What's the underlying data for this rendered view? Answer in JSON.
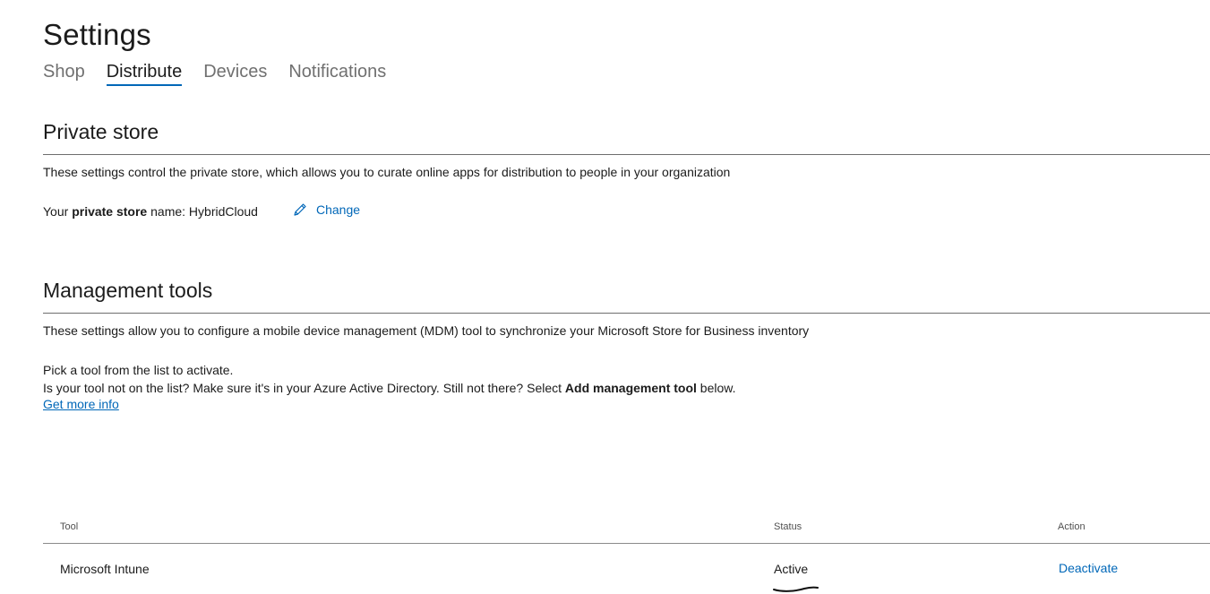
{
  "page": {
    "title": "Settings"
  },
  "tabs": [
    {
      "label": "Shop",
      "active": false
    },
    {
      "label": "Distribute",
      "active": true
    },
    {
      "label": "Devices",
      "active": false
    },
    {
      "label": "Notifications",
      "active": false
    }
  ],
  "private_store": {
    "heading": "Private store",
    "description": "These settings control the private store, which allows you to curate online apps for distribution to people in your organization",
    "name_prefix": "Your ",
    "name_bold": "private store",
    "name_suffix": " name: HybridCloud",
    "change_label": "Change",
    "change_icon": "pencil-icon"
  },
  "management_tools": {
    "heading": "Management tools",
    "description": "These settings allow you to configure a mobile device management (MDM) tool to synchronize your Microsoft Store for Business inventory",
    "pick_text": "Pick a tool from the list to activate.",
    "not_listed_prefix": "Is your tool not on the list? Make sure it's in your Azure Active Directory. Still not there? Select ",
    "not_listed_bold": "Add management tool",
    "not_listed_suffix": " below.",
    "more_info_label": "Get more info"
  },
  "table": {
    "headers": {
      "tool": "Tool",
      "status": "Status",
      "action": "Action"
    },
    "rows": [
      {
        "tool": "Microsoft Intune",
        "status": "Active",
        "action": "Deactivate"
      }
    ]
  },
  "colors": {
    "accent": "#0067b8",
    "text": "#1b1b1b",
    "muted": "#707070"
  }
}
